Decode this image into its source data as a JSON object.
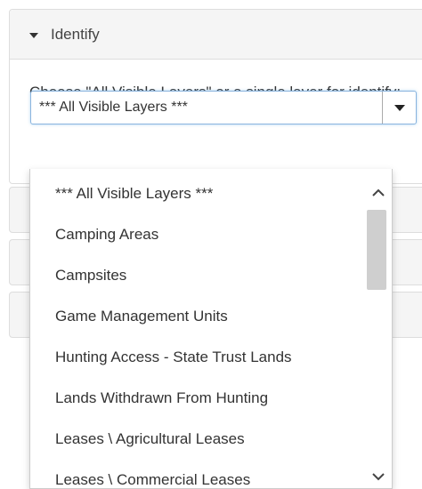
{
  "panel": {
    "title": "Identify",
    "instructions": "Choose \"All Visible Layers\" or a single layer for identify:"
  },
  "select": {
    "value": "*** All Visible Layers ***"
  },
  "dropdown": {
    "options": [
      "*** All Visible Layers ***",
      "Camping Areas",
      "Campsites",
      "Game Management Units",
      "Hunting Access - State Trust Lands",
      "Lands Withdrawn From Hunting",
      "Leases \\ Agricultural Leases",
      "Leases \\ Commercial Leases"
    ]
  },
  "colors": {
    "heading_bg": "#f5f5f5",
    "border": "#dddddd",
    "focus_border": "#8ab4de",
    "scroll_thumb": "#cfcfcf"
  },
  "icons": {
    "heading_caret": "caret-down-icon",
    "select_arrow": "dropdown-arrow-icon",
    "scroll_up": "chevron-up-icon",
    "scroll_down": "chevron-down-icon"
  }
}
